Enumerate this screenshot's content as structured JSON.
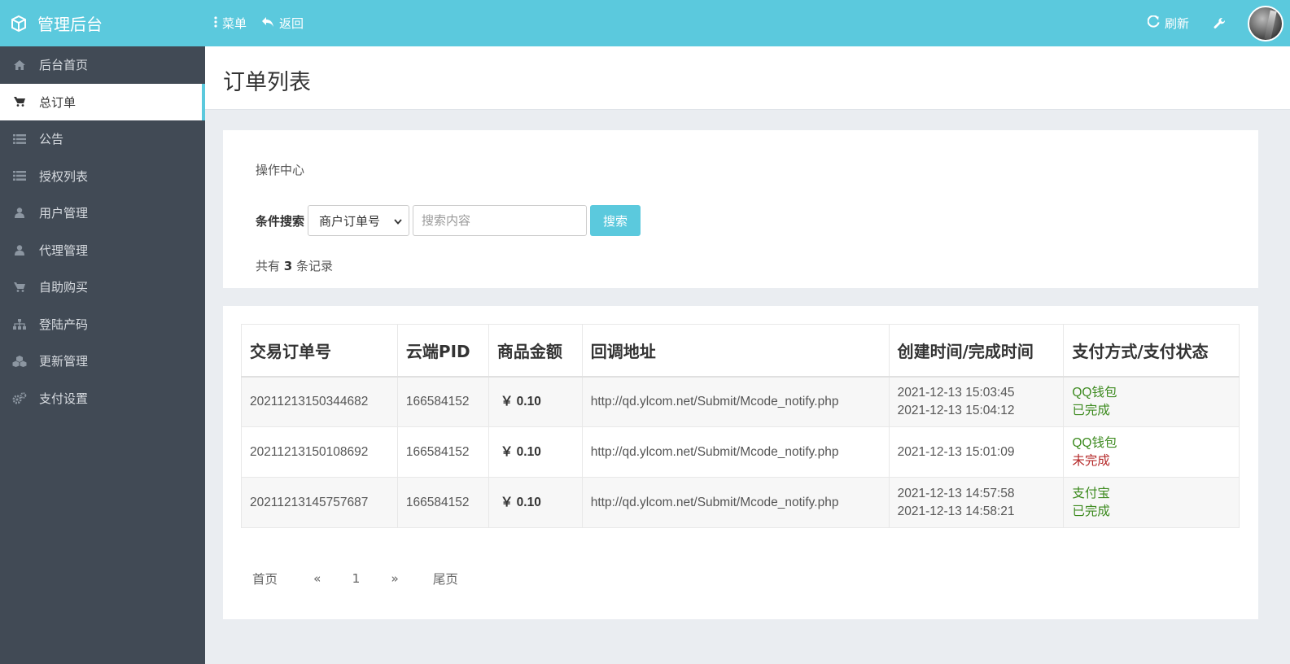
{
  "app": {
    "title": "管理后台"
  },
  "topnav": {
    "menu": "菜单",
    "back": "返回",
    "refresh": "刷新"
  },
  "sidebar": {
    "items": [
      {
        "label": "后台首页",
        "icon": "home-icon"
      },
      {
        "label": "总订单",
        "icon": "cart-icon",
        "active": true
      },
      {
        "label": "公告",
        "icon": "list-icon"
      },
      {
        "label": "授权列表",
        "icon": "list-icon"
      },
      {
        "label": "用户管理",
        "icon": "user-icon"
      },
      {
        "label": "代理管理",
        "icon": "user-icon"
      },
      {
        "label": "自助购买",
        "icon": "cart-icon"
      },
      {
        "label": "登陆产码",
        "icon": "sitemap-icon"
      },
      {
        "label": "更新管理",
        "icon": "cubes-icon"
      },
      {
        "label": "支付设置",
        "icon": "cogs-icon"
      }
    ]
  },
  "page": {
    "title": "订单列表"
  },
  "ops": {
    "title": "操作中心",
    "search_label": "条件搜索",
    "select_value": "商户订单号",
    "input_placeholder": "搜索内容",
    "search_button": "搜索",
    "count_prefix": "共有",
    "count": "3",
    "count_suffix": "条记录"
  },
  "table": {
    "headers": [
      "交易订单号",
      "云端PID",
      "商品金额",
      "回调地址",
      "创建时间/完成时间",
      "支付方式/支付状态"
    ],
    "rows": [
      {
        "order": "20211213150344682",
        "pid": "166584152",
        "amount": "￥ 0.10",
        "url": "http://qd.ylcom.net/Submit/Mcode_notify.php",
        "created": "2021-12-13 15:03:45",
        "finished": "2021-12-13 15:04:12",
        "method": "QQ钱包",
        "status": "已完成"
      },
      {
        "order": "20211213150108692",
        "pid": "166584152",
        "amount": "￥ 0.10",
        "url": "http://qd.ylcom.net/Submit/Mcode_notify.php",
        "created": "2021-12-13 15:01:09",
        "finished": "",
        "method": "QQ钱包",
        "status": "未完成"
      },
      {
        "order": "20211213145757687",
        "pid": "166584152",
        "amount": "￥ 0.10",
        "url": "http://qd.ylcom.net/Submit/Mcode_notify.php",
        "created": "2021-12-13 14:57:58",
        "finished": "2021-12-13 14:58:21",
        "method": "支付宝",
        "status": "已完成"
      }
    ]
  },
  "pager": {
    "first": "首页",
    "prev": "«",
    "current": "1",
    "next": "»",
    "last": "尾页"
  },
  "colors": {
    "accent": "#5bc9dd",
    "sidebar": "#414a55",
    "success": "#3c8a1e",
    "danger": "#b52a2a"
  }
}
